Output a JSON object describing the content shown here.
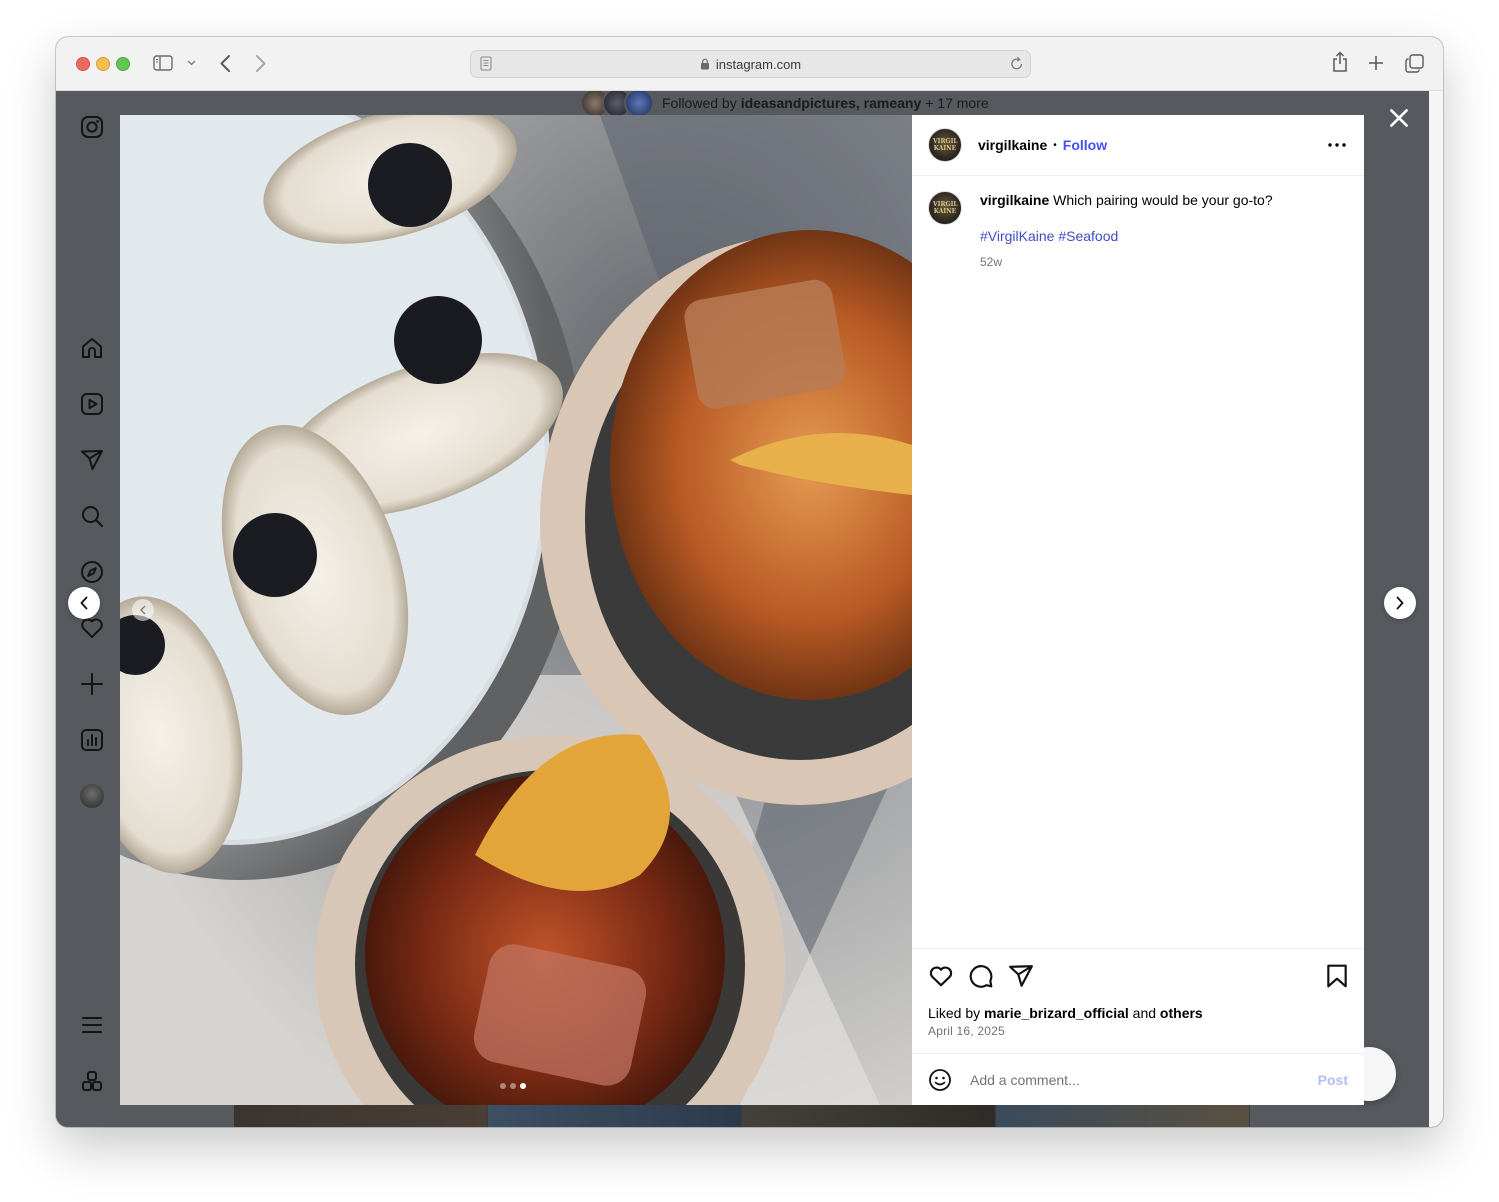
{
  "browser": {
    "url": "instagram.com"
  },
  "background_page": {
    "followed_by_prefix": "Followed by",
    "followed_by_users": "ideasandpictures, rameany",
    "followed_by_more": "+ 17 more"
  },
  "sidebar": {
    "items": [
      {
        "name": "instagram-logo-icon"
      },
      {
        "name": "home-icon"
      },
      {
        "name": "reels-icon"
      },
      {
        "name": "messages-icon"
      },
      {
        "name": "search-icon"
      },
      {
        "name": "explore-icon"
      },
      {
        "name": "notifications-icon"
      },
      {
        "name": "create-icon"
      },
      {
        "name": "dashboard-icon"
      },
      {
        "name": "profile-avatar"
      },
      {
        "name": "more-menu-icon"
      },
      {
        "name": "also-from-meta-icon"
      }
    ]
  },
  "post": {
    "username": "virgilkaine",
    "separator": "•",
    "follow_label": "Follow",
    "caption": "Which pairing would be your go-to?",
    "hashtags": "#VirgilKaine #Seafood",
    "age": "52w",
    "liked_by_prefix": "Liked by",
    "liked_by_user": "marie_brizard_official",
    "liked_by_and": "and",
    "liked_by_others": "others",
    "date": "April 16, 2025",
    "comment_placeholder": "Add a comment...",
    "post_label": "Post",
    "avatar_text": "VIRGIL KAINE",
    "carousel_slides": 3,
    "carousel_active": 3
  },
  "colors": {
    "accent_link": "#4150f7",
    "hashtag": "#3d4ec4",
    "overlay": "#56595e"
  }
}
